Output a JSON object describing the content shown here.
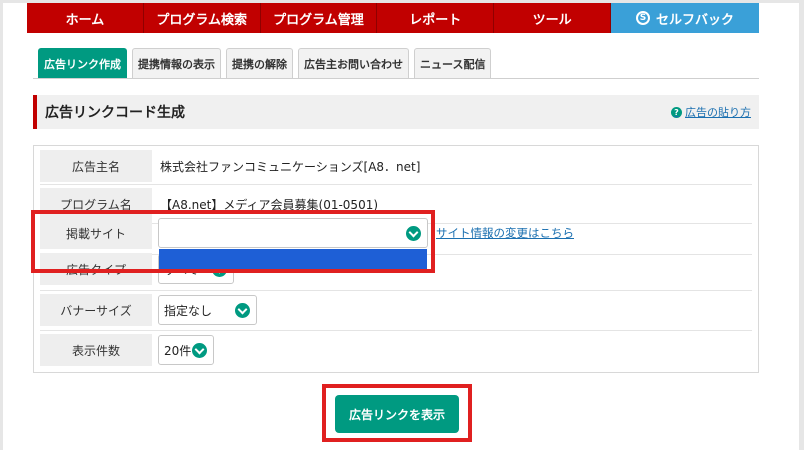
{
  "nav": {
    "items": [
      "ホーム",
      "プログラム検索",
      "プログラム管理",
      "レポート",
      "ツール"
    ],
    "selfback": {
      "icon": "S",
      "label": "セルフバック"
    }
  },
  "tabs": [
    "広告リンク作成",
    "提携情報の表示",
    "提携の解除",
    "広告主お問い合わせ",
    "ニュース配信"
  ],
  "active_tab": "広告リンク作成",
  "section": {
    "title": "広告リンクコード生成",
    "help_icon": "?",
    "help_link": "広告の貼り方"
  },
  "form": {
    "advertiser": {
      "label": "広告主名",
      "value": "株式会社ファンコミュニケーションズ[A8．net]"
    },
    "program": {
      "label": "プログラム名",
      "value": "【A8.net】メディア会員募集(01-0501)"
    },
    "site": {
      "label": "掲載サイト",
      "value": "",
      "change_link": "サイト情報の変更はこちら"
    },
    "ad_type": {
      "label": "広告タイプ",
      "value": "すべて"
    },
    "banner_size": {
      "label": "バナーサイズ",
      "value": "指定なし"
    },
    "display_count": {
      "label": "表示件数",
      "value": "20件"
    }
  },
  "submit_label": "広告リンクを表示",
  "colors": {
    "brand_red": "#c10000",
    "accent_green": "#009a81",
    "selfback_blue": "#3aa0d8",
    "highlight_red": "#e02020"
  }
}
